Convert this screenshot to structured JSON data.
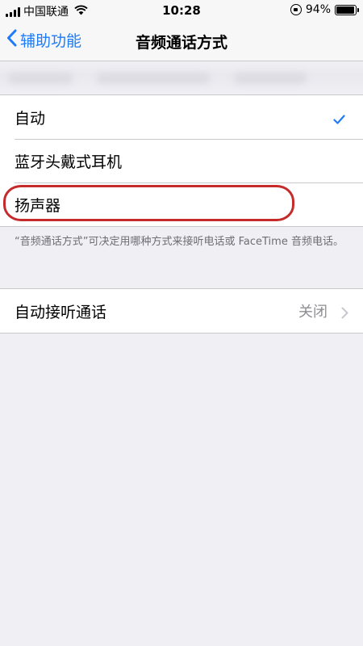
{
  "status_bar": {
    "carrier": "中国联通",
    "time": "10:28",
    "battery_text": "94%",
    "battery_level": 0.94,
    "signal_bars": 4
  },
  "nav": {
    "back_label": "辅助功能",
    "title": "音频通话方式",
    "accent_color": "#1f7bf6"
  },
  "options": [
    {
      "label": "自动",
      "selected": true
    },
    {
      "label": "蓝牙头戴式耳机",
      "selected": false
    },
    {
      "label": "扬声器",
      "selected": false
    }
  ],
  "footnote": "“音频通话方式”可决定用哪种方式来接听电话或 FaceTime 音频电话。",
  "auto_answer": {
    "label": "自动接听通话",
    "value": "关闭"
  },
  "highlight_color": "#c62b2b"
}
